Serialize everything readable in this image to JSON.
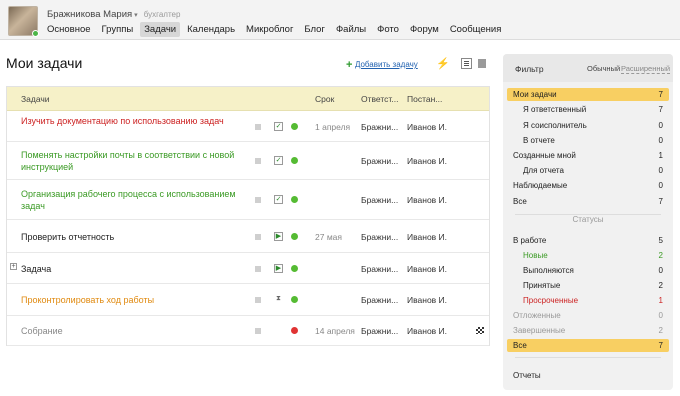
{
  "user": {
    "name": "Бражникова Мария",
    "caret": "▾",
    "role": "бухгалтер"
  },
  "nav": [
    {
      "label": "Основное",
      "active": false
    },
    {
      "label": "Группы",
      "active": false
    },
    {
      "label": "Задачи",
      "active": true
    },
    {
      "label": "Календарь",
      "active": false
    },
    {
      "label": "Микроблог",
      "active": false
    },
    {
      "label": "Блог",
      "active": false
    },
    {
      "label": "Файлы",
      "active": false
    },
    {
      "label": "Фото",
      "active": false
    },
    {
      "label": "Форум",
      "active": false
    },
    {
      "label": "Сообщения",
      "active": false
    }
  ],
  "page": {
    "title": "Мои задачи",
    "add_plus": "+",
    "add_label": "Добавить задачу"
  },
  "table": {
    "headers": {
      "task": "Задачи",
      "deadline": "Срок",
      "responsible": "Ответст...",
      "creator": "Постан..."
    },
    "rows": [
      {
        "title": "Изучить документацию по использованию задач",
        "color": "#cc2222",
        "status": "in-progress",
        "dot": "#55bb33",
        "date": "1 апреля",
        "responsible": "Бражни...",
        "creator": "Иванов И."
      },
      {
        "title": "Поменять настройки почты в соответствии с новой инструкцией",
        "color": "#3a9a24",
        "status": "in-progress",
        "dot": "#55bb33",
        "date": "",
        "responsible": "Бражни...",
        "creator": "Иванов И."
      },
      {
        "title": "Организация рабочего процесса с использованием задач",
        "color": "#3a9a24",
        "status": "in-progress",
        "dot": "#55bb33",
        "date": "",
        "responsible": "Бражни...",
        "creator": "Иванов И."
      },
      {
        "title": "Проверить отчетность",
        "color": "#222222",
        "status": "play",
        "dot": "#55bb33",
        "date": "27 мая",
        "responsible": "Бражни...",
        "creator": "Иванов И."
      },
      {
        "title": "Задача",
        "color": "#222222",
        "status": "play",
        "dot": "#55bb33",
        "date": "",
        "responsible": "Бражни...",
        "creator": "Иванов И.",
        "expandable": true
      },
      {
        "title": "Проконтролировать ход работы",
        "color": "#e08a10",
        "status": "waiting",
        "dot": "#55bb33",
        "date": "",
        "responsible": "Бражни...",
        "creator": "Иванов И."
      },
      {
        "title": "Собрание",
        "color": "#888888",
        "status": "none",
        "dot": "#e03333",
        "date": "14 апреля",
        "responsible": "Бражни...",
        "creator": "Иванов И.",
        "flag": true
      }
    ]
  },
  "sidebar": {
    "title": "Фильтр",
    "mode_normal": "Обычный",
    "mode_extended": "Расширенный",
    "roles": [
      {
        "label": "Мои задачи",
        "count": "7",
        "active": true,
        "indent": false,
        "color": "#222222"
      },
      {
        "label": "Я ответственный",
        "count": "7",
        "active": false,
        "indent": true,
        "color": "#222222"
      },
      {
        "label": "Я соисполнитель",
        "count": "0",
        "active": false,
        "indent": true,
        "color": "#222222"
      },
      {
        "label": "В отчете",
        "count": "0",
        "active": false,
        "indent": true,
        "color": "#222222"
      },
      {
        "label": "Созданные мной",
        "count": "1",
        "active": false,
        "indent": false,
        "color": "#222222"
      },
      {
        "label": "Для отчета",
        "count": "0",
        "active": false,
        "indent": true,
        "color": "#222222"
      },
      {
        "label": "Наблюдаемые",
        "count": "0",
        "active": false,
        "indent": false,
        "color": "#222222"
      },
      {
        "label": "Все",
        "count": "7",
        "active": false,
        "indent": false,
        "color": "#222222"
      }
    ],
    "status_header": "Статусы",
    "statuses": [
      {
        "label": "В работе",
        "count": "5",
        "active": false,
        "indent": false,
        "color": "#222222"
      },
      {
        "label": "Новые",
        "count": "2",
        "active": false,
        "indent": true,
        "color": "#3a9a24"
      },
      {
        "label": "Выполняются",
        "count": "0",
        "active": false,
        "indent": true,
        "color": "#222222"
      },
      {
        "label": "Принятые",
        "count": "2",
        "active": false,
        "indent": true,
        "color": "#222222"
      },
      {
        "label": "Просроченные",
        "count": "1",
        "active": false,
        "indent": true,
        "color": "#cc2222"
      },
      {
        "label": "Отложенные",
        "count": "0",
        "active": false,
        "indent": false,
        "color": "#999999"
      },
      {
        "label": "Завершенные",
        "count": "2",
        "active": false,
        "indent": false,
        "color": "#999999"
      },
      {
        "label": "Все",
        "count": "7",
        "active": true,
        "indent": false,
        "color": "#222222"
      }
    ],
    "reports": "Отчеты"
  }
}
